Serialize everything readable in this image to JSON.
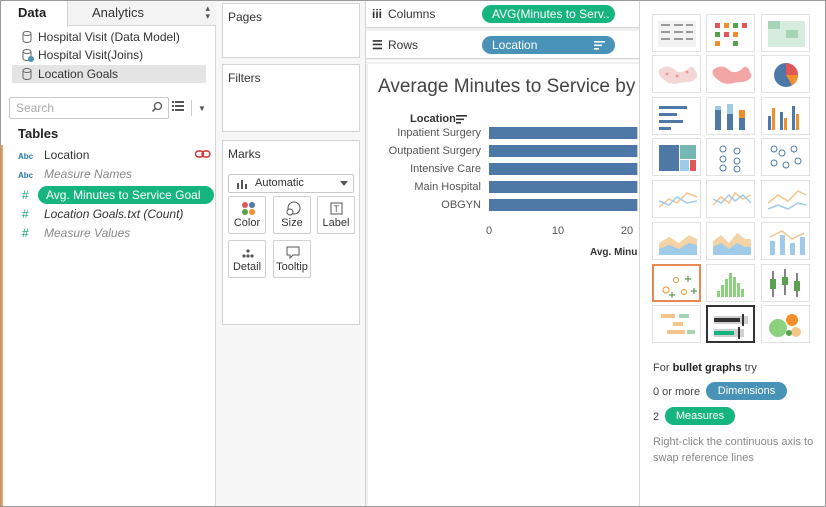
{
  "tabs": {
    "data": "Data",
    "analytics": "Analytics"
  },
  "datasources": [
    "Hospital Visit (Data Model)",
    "Hospital Visit(Joins)",
    "Location Goals"
  ],
  "search": {
    "placeholder": "Search"
  },
  "tables_heading": "Tables",
  "fields": [
    {
      "type": "Abc",
      "name": "Location"
    },
    {
      "type": "Abc",
      "name": "Measure Names"
    },
    {
      "type": "#",
      "name": "Avg. Minutes to Service Goal"
    },
    {
      "type": "#",
      "name": "Location Goals.txt (Count)"
    },
    {
      "type": "#",
      "name": "Measure Values"
    }
  ],
  "cards": {
    "pages": "Pages",
    "filters": "Filters",
    "marks": "Marks"
  },
  "marks": {
    "type": "Automatic",
    "buttons": [
      "Color",
      "Size",
      "Label",
      "Detail",
      "Tooltip"
    ]
  },
  "shelves": {
    "columns_label": "Columns",
    "columns_pill": "AVG(Minutes to Serv..",
    "rows_label": "Rows",
    "rows_pill": "Location"
  },
  "viz": {
    "title": "Average Minutes to Service by",
    "row_header": "Location",
    "axis_label": "Avg. Minu"
  },
  "chart_data": {
    "type": "bar",
    "orientation": "horizontal",
    "categories": [
      "Inpatient Surgery",
      "Outpatient Surgery",
      "Intensive Care",
      "Main Hospital",
      "OBGYN"
    ],
    "values": [
      21.5,
      21.5,
      21.5,
      21.5,
      21.5
    ],
    "xticks": [
      0,
      10,
      20
    ],
    "xlim": [
      0,
      22.2
    ],
    "xlabel": "Avg. Minu",
    "ylabel": "Location",
    "bar_color": "#4e79a7"
  },
  "showme": {
    "hint_prefix": "For ",
    "hint_bold": "bullet graphs",
    "hint_suffix": " try",
    "dim_prefix": "0 or more",
    "dim_pill": "Dimensions",
    "meas_prefix": "2",
    "meas_pill": "Measures",
    "note": "Right-click the continuous axis to swap reference lines"
  },
  "colors": {
    "green": "#16b47e",
    "blue": "#4a93b8",
    "accent": "#e58a52"
  }
}
